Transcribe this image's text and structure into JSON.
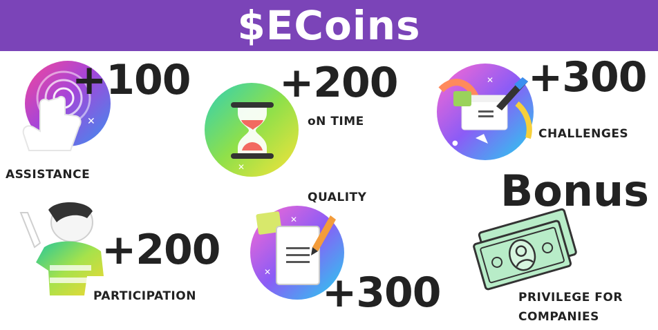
{
  "header": {
    "title": "$ECoins"
  },
  "rewards": [
    {
      "points": "+100",
      "label": "ASSISTANCE",
      "icon": "touch-hand-icon"
    },
    {
      "points": "+200",
      "label": "oN TIME",
      "icon": "hourglass-icon"
    },
    {
      "points": "+300",
      "label": "CHALLENGES",
      "icon": "browser-window-pen-icon"
    },
    {
      "points": "+200",
      "label": "PARTICIPATION",
      "icon": "waving-person-icon"
    },
    {
      "points": "+300",
      "label": "QUALITY",
      "icon": "notepad-pencil-icon"
    }
  ],
  "bonus": {
    "title": "Bonus",
    "label_line1": "PRIVILEGE FOR",
    "label_line2": "COMPANIES",
    "icon": "dollar-bills-icon"
  },
  "colors": {
    "header_background": "#7b44b8",
    "header_text": "#ffffff",
    "text": "#222222",
    "bill_green": "#b8ecc8"
  }
}
